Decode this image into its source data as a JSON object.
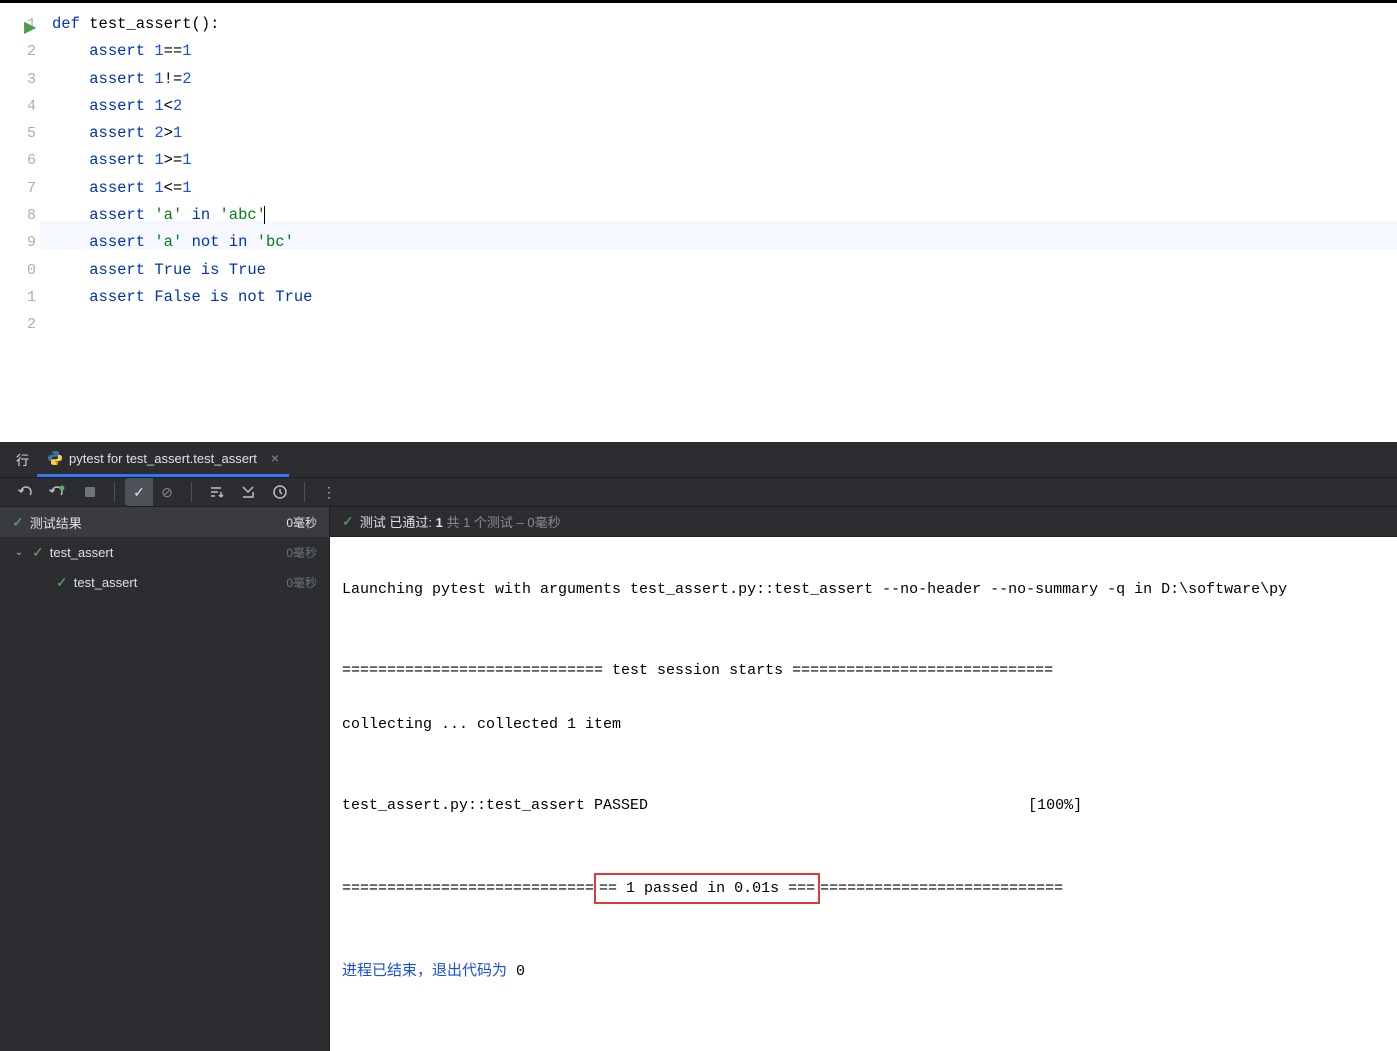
{
  "editor": {
    "lines": [
      {
        "n": "1",
        "tokens": [
          {
            "t": "def ",
            "c": "kw"
          },
          {
            "t": "test_assert():",
            "c": "fn"
          }
        ],
        "runIcon": true
      },
      {
        "n": "2",
        "tokens": [
          {
            "t": "    ",
            "c": "op"
          },
          {
            "t": "assert ",
            "c": "kw"
          },
          {
            "t": "1",
            "c": "num"
          },
          {
            "t": "==",
            "c": "op"
          },
          {
            "t": "1",
            "c": "num"
          }
        ]
      },
      {
        "n": "3",
        "tokens": [
          {
            "t": "    ",
            "c": "op"
          },
          {
            "t": "assert ",
            "c": "kw"
          },
          {
            "t": "1",
            "c": "num"
          },
          {
            "t": "!=",
            "c": "op"
          },
          {
            "t": "2",
            "c": "num"
          }
        ]
      },
      {
        "n": "4",
        "tokens": [
          {
            "t": "    ",
            "c": "op"
          },
          {
            "t": "assert ",
            "c": "kw"
          },
          {
            "t": "1",
            "c": "num"
          },
          {
            "t": "<",
            "c": "op"
          },
          {
            "t": "2",
            "c": "num"
          }
        ]
      },
      {
        "n": "5",
        "tokens": [
          {
            "t": "    ",
            "c": "op"
          },
          {
            "t": "assert ",
            "c": "kw"
          },
          {
            "t": "2",
            "c": "num"
          },
          {
            "t": ">",
            "c": "op"
          },
          {
            "t": "1",
            "c": "num"
          }
        ]
      },
      {
        "n": "6",
        "tokens": [
          {
            "t": "    ",
            "c": "op"
          },
          {
            "t": "assert ",
            "c": "kw"
          },
          {
            "t": "1",
            "c": "num"
          },
          {
            "t": ">=",
            "c": "op"
          },
          {
            "t": "1",
            "c": "num"
          }
        ]
      },
      {
        "n": "7",
        "tokens": [
          {
            "t": "    ",
            "c": "op"
          },
          {
            "t": "assert ",
            "c": "kw"
          },
          {
            "t": "1",
            "c": "num"
          },
          {
            "t": "<=",
            "c": "op"
          },
          {
            "t": "1",
            "c": "num"
          }
        ]
      },
      {
        "n": "8",
        "tokens": [
          {
            "t": "",
            "c": "op"
          }
        ]
      },
      {
        "n": "9",
        "tokens": [
          {
            "t": "    ",
            "c": "op"
          },
          {
            "t": "assert ",
            "c": "kw"
          },
          {
            "t": "'a' ",
            "c": "str"
          },
          {
            "t": "in ",
            "c": "kw"
          },
          {
            "t": "'abc'",
            "c": "str"
          }
        ],
        "caret": true,
        "highlight": true
      },
      {
        "n": "0",
        "tokens": [
          {
            "t": "    ",
            "c": "op"
          },
          {
            "t": "assert ",
            "c": "kw"
          },
          {
            "t": "'a' ",
            "c": "str"
          },
          {
            "t": "not in ",
            "c": "kw"
          },
          {
            "t": "'bc'",
            "c": "str"
          }
        ]
      },
      {
        "n": "1",
        "tokens": [
          {
            "t": "    ",
            "c": "op"
          },
          {
            "t": "assert ",
            "c": "kw"
          },
          {
            "t": "True ",
            "c": "kw"
          },
          {
            "t": "is ",
            "c": "kw"
          },
          {
            "t": "True",
            "c": "kw"
          }
        ]
      },
      {
        "n": "2",
        "tokens": [
          {
            "t": "    ",
            "c": "op"
          },
          {
            "t": "assert ",
            "c": "kw"
          },
          {
            "t": "False ",
            "c": "kw"
          },
          {
            "t": "is not ",
            "c": "kw"
          },
          {
            "t": "True",
            "c": "kw"
          }
        ]
      }
    ]
  },
  "tabbar": {
    "lead": "行",
    "tab_label": "pytest for test_assert.test_assert"
  },
  "tree": {
    "header_label": "测试结果",
    "header_time": "0毫秒",
    "items": [
      {
        "label": "test_assert",
        "time": "0毫秒",
        "indent": 0,
        "chev": true
      },
      {
        "label": "test_assert",
        "time": "0毫秒",
        "indent": 1,
        "chev": false
      }
    ]
  },
  "console_header": {
    "prefix": "测试 已通过:",
    "bold": "1",
    "suffix": "共 1 个测试 – 0毫秒"
  },
  "console": {
    "l1": "Launching pytest with arguments test_assert.py::test_assert --no-header --no-summary -q in D:\\software\\py",
    "l2": "",
    "l3": "============================= test session starts =============================",
    "l4": "collecting ... collected 1 item",
    "l5": "",
    "l6a": "test_assert.py::test_assert PASSED",
    "l6b": "[100%]",
    "l7": "",
    "l8a": "============================",
    "l8box": "== 1 passed in 0.01s ===",
    "l8b": "===========================",
    "l9": "",
    "exit_prefix": "进程已结束，退出代码为 ",
    "exit_code": "0"
  }
}
